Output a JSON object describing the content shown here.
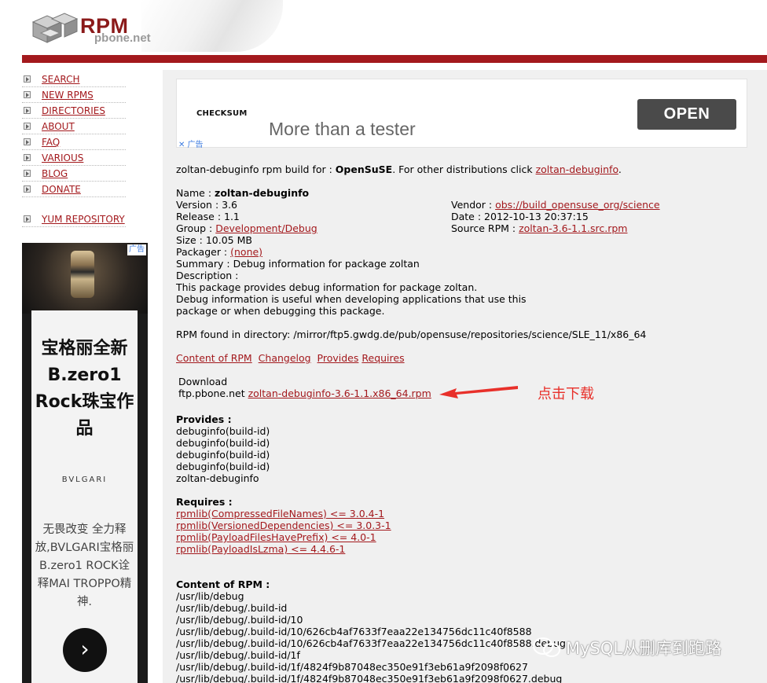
{
  "header": {
    "logo_text": "RPM",
    "logo_subtext": "pbone.net"
  },
  "nav": {
    "items": [
      {
        "label": "SEARCH"
      },
      {
        "label": "NEW RPMS"
      },
      {
        "label": "DIRECTORIES"
      },
      {
        "label": "ABOUT"
      },
      {
        "label": "FAQ"
      },
      {
        "label": "VARIOUS"
      },
      {
        "label": "BLOG"
      },
      {
        "label": "DONATE"
      }
    ],
    "yum_label": "YUM REPOSITORY"
  },
  "left_ad": {
    "badge": "广告",
    "headline": "宝格丽全新B.zero1 Rock珠宝作品",
    "brand": "BVLGARI",
    "body": "无畏改变 全力释放,BVLGARI宝格丽B.zero1 ROCK诠释MAI TROPPO精神.",
    "arrow": "›"
  },
  "top_ad": {
    "checksum": "CHECKSUM",
    "tagline": "More than a tester",
    "open": "OPEN",
    "adchoice": "✕ 广告"
  },
  "package": {
    "intro_prefix": "zoltan-debuginfo rpm build for : ",
    "intro_dist": "OpenSuSE",
    "intro_mid": ". For other distributions click ",
    "intro_link": "zoltan-debuginfo",
    "intro_end": ".",
    "name_label": "Name : ",
    "name": "zoltan-debuginfo",
    "version": "Version : 3.6",
    "release": "Release : 1.1",
    "group_label": "Group : ",
    "group": "Development/Debug",
    "size": "Size : 10.05 MB",
    "packager_label": "Packager : ",
    "packager": "(none)",
    "summary": "Summary : Debug information for package zoltan",
    "description_label": "Description :",
    "description_lines": [
      "This package provides debug information for package zoltan.",
      "Debug information is useful when developing applications that use this",
      "package or when debugging this package."
    ],
    "vendor_label": "Vendor : ",
    "vendor": "obs://build_opensuse_org/science",
    "date": "Date : 2012-10-13 20:37:15",
    "source_label": "Source RPM : ",
    "source": "zoltan-3.6-1.1.src.rpm",
    "directory": "RPM found in directory: /mirror/ftp5.gwdg.de/pub/opensuse/repositories/science/SLE_11/x86_64",
    "tabs": [
      "Content of RPM",
      "Changelog",
      "Provides",
      "Requires"
    ],
    "download_label": "Download",
    "download_host": "ftp.pbone.net ",
    "download_file": "zoltan-debuginfo-3.6-1.1.x86_64.rpm",
    "annotation": "点击下载",
    "provides_label": "Provides :",
    "provides": [
      "debuginfo(build-id)",
      "debuginfo(build-id)",
      "debuginfo(build-id)",
      "debuginfo(build-id)",
      "zoltan-debuginfo"
    ],
    "requires_label": "Requires :",
    "requires": [
      {
        "name": "rpmlib(CompressedFileNames)",
        "ver": " <= 3.0.4-1"
      },
      {
        "name": "rpmlib(VersionedDependencies)",
        "ver": " <= 3.0.3-1"
      },
      {
        "name": "rpmlib(PayloadFilesHavePrefix)",
        "ver": " <= 4.0-1"
      },
      {
        "name": "rpmlib(PayloadIsLzma)",
        "ver": " <= 4.4.6-1"
      }
    ],
    "content_label": "Content of RPM :",
    "content": [
      "/usr/lib/debug",
      "/usr/lib/debug/.build-id",
      "/usr/lib/debug/.build-id/10",
      "/usr/lib/debug/.build-id/10/626cb4af7633f7eaa22e134756dc11c40f8588",
      "/usr/lib/debug/.build-id/10/626cb4af7633f7eaa22e134756dc11c40f8588.debug",
      "/usr/lib/debug/.build-id/1f",
      "/usr/lib/debug/.build-id/1f/4824f9b87048ec350e91f3eb61a9f2098f0627",
      "/usr/lib/debug/.build-id/1f/4824f9b87048ec350e91f3eb61a9f2098f0627.debug"
    ]
  },
  "watermark": "MySQL从删库到跑路"
}
